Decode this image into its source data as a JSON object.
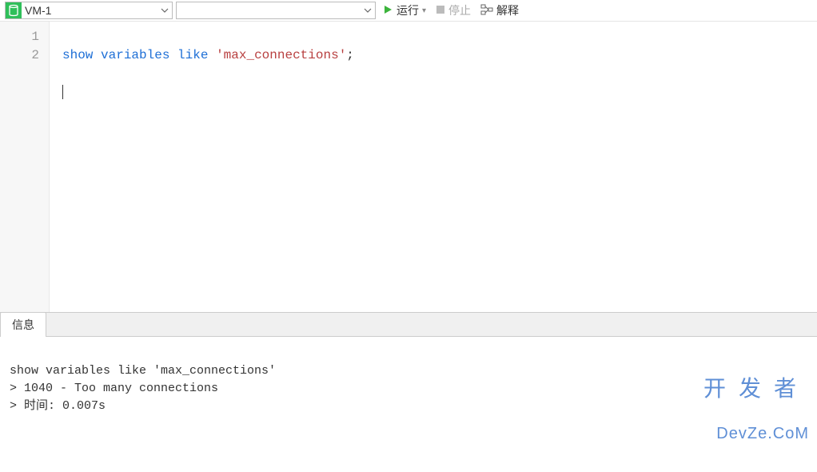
{
  "toolbar": {
    "connection": "VM-1",
    "database": "",
    "run_label": "运行",
    "stop_label": "停止",
    "explain_label": "解释"
  },
  "editor": {
    "lines": {
      "l1_kw1": "show",
      "l1_kw2": "variables",
      "l1_kw3": "like",
      "l1_str": "'max_connections'",
      "l1_end": ";"
    },
    "line_numbers": [
      "1",
      "2"
    ]
  },
  "tabs": {
    "info": "信息"
  },
  "output": {
    "line1": "show variables like 'max_connections'",
    "line2": "> 1040 - Too many connections",
    "line3": "> 时间: 0.007s"
  },
  "watermark": {
    "cn": "开发者",
    "en": "DevZe.CoM"
  }
}
